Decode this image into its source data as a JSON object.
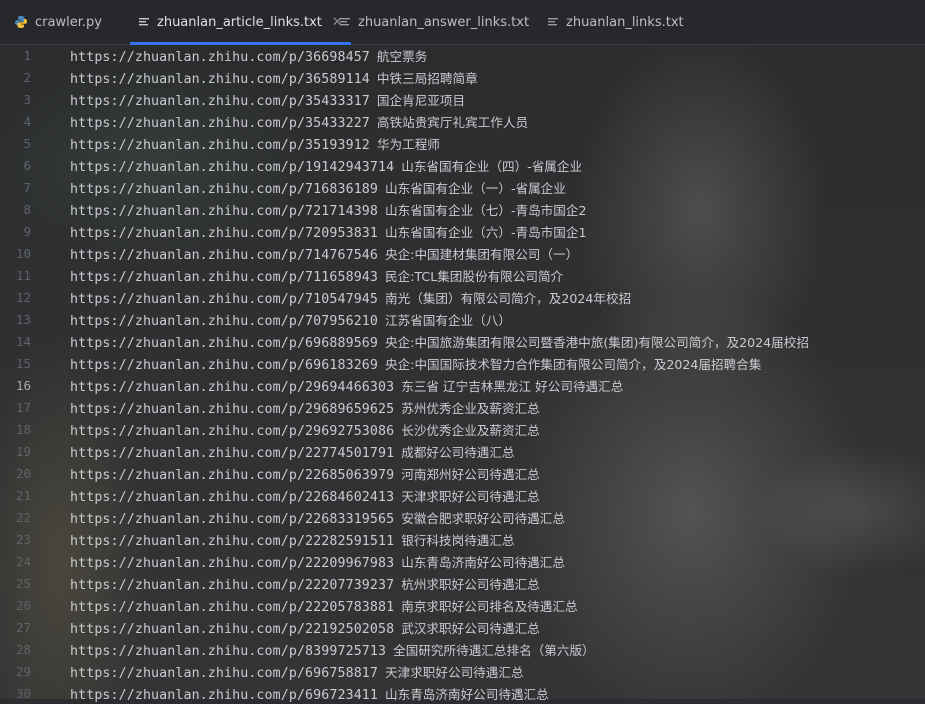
{
  "tabs": [
    {
      "label": "crawler.py",
      "icon": "python-file-icon",
      "active": false
    },
    {
      "label": "zhuanlan_article_links.txt",
      "icon": "text-file-icon",
      "active": true,
      "closable": true
    },
    {
      "label": "zhuanlan_answer_links.txt",
      "icon": "text-file-icon",
      "active": false
    },
    {
      "label": "zhuanlan_links.txt",
      "icon": "text-file-icon",
      "active": false
    }
  ],
  "current_line": 16,
  "lines": [
    {
      "n": "1",
      "url": "https://zhuanlan.zhihu.com/p/36698457",
      "title": "航空票务"
    },
    {
      "n": "2",
      "url": "https://zhuanlan.zhihu.com/p/36589114",
      "title": "中铁三局招聘简章"
    },
    {
      "n": "3",
      "url": "https://zhuanlan.zhihu.com/p/35433317",
      "title": "国企肯尼亚项目"
    },
    {
      "n": "4",
      "url": "https://zhuanlan.zhihu.com/p/35433227",
      "title": "高铁站贵宾厅礼宾工作人员"
    },
    {
      "n": "5",
      "url": "https://zhuanlan.zhihu.com/p/35193912",
      "title": "华为工程师"
    },
    {
      "n": "6",
      "url": "https://zhuanlan.zhihu.com/p/19142943714",
      "title": "山东省国有企业（四）-省属企业"
    },
    {
      "n": "7",
      "url": "https://zhuanlan.zhihu.com/p/716836189",
      "title": "山东省国有企业（一）-省属企业"
    },
    {
      "n": "8",
      "url": "https://zhuanlan.zhihu.com/p/721714398",
      "title": "山东省国有企业（七）-青岛市国企2"
    },
    {
      "n": "9",
      "url": "https://zhuanlan.zhihu.com/p/720953831",
      "title": "山东省国有企业（六）-青岛市国企1"
    },
    {
      "n": "10",
      "url": "https://zhuanlan.zhihu.com/p/714767546",
      "title": "央企:中国建材集团有限公司（一）"
    },
    {
      "n": "11",
      "url": "https://zhuanlan.zhihu.com/p/711658943",
      "title": "民企:TCL集团股份有限公司简介"
    },
    {
      "n": "12",
      "url": "https://zhuanlan.zhihu.com/p/710547945",
      "title": "南光（集团）有限公司简介，及2024年校招"
    },
    {
      "n": "13",
      "url": "https://zhuanlan.zhihu.com/p/707956210",
      "title": "江苏省国有企业（八）"
    },
    {
      "n": "14",
      "url": "https://zhuanlan.zhihu.com/p/696889569",
      "title": "央企:中国旅游集团有限公司暨香港中旅(集团)有限公司简介，及2024届校招"
    },
    {
      "n": "15",
      "url": "https://zhuanlan.zhihu.com/p/696183269",
      "title": "央企:中国国际技术智力合作集团有限公司简介，及2024届招聘合集"
    },
    {
      "n": "16",
      "url": "https://zhuanlan.zhihu.com/p/29694466303",
      "title": "东三省  辽宁吉林黑龙江  好公司待遇汇总"
    },
    {
      "n": "17",
      "url": "https://zhuanlan.zhihu.com/p/29689659625",
      "title": "苏州优秀企业及薪资汇总"
    },
    {
      "n": "18",
      "url": "https://zhuanlan.zhihu.com/p/29692753086",
      "title": "长沙优秀企业及薪资汇总"
    },
    {
      "n": "19",
      "url": "https://zhuanlan.zhihu.com/p/22774501791",
      "title": "成都好公司待遇汇总"
    },
    {
      "n": "20",
      "url": "https://zhuanlan.zhihu.com/p/22685063979",
      "title": "河南郑州好公司待遇汇总"
    },
    {
      "n": "21",
      "url": "https://zhuanlan.zhihu.com/p/22684602413",
      "title": "天津求职好公司待遇汇总"
    },
    {
      "n": "22",
      "url": "https://zhuanlan.zhihu.com/p/22683319565",
      "title": "安徽合肥求职好公司待遇汇总"
    },
    {
      "n": "23",
      "url": "https://zhuanlan.zhihu.com/p/22282591511",
      "title": "银行科技岗待遇汇总"
    },
    {
      "n": "24",
      "url": "https://zhuanlan.zhihu.com/p/22209967983",
      "title": "山东青岛济南好公司待遇汇总"
    },
    {
      "n": "25",
      "url": "https://zhuanlan.zhihu.com/p/22207739237",
      "title": "杭州求职好公司待遇汇总"
    },
    {
      "n": "26",
      "url": "https://zhuanlan.zhihu.com/p/22205783881",
      "title": "南京求职好公司排名及待遇汇总"
    },
    {
      "n": "27",
      "url": "https://zhuanlan.zhihu.com/p/22192502058",
      "title": "武汉求职好公司待遇汇总"
    },
    {
      "n": "28",
      "url": "https://zhuanlan.zhihu.com/p/8399725713",
      "title": "全国研究所待遇汇总排名（第六版）"
    },
    {
      "n": "29",
      "url": "https://zhuanlan.zhihu.com/p/696758817",
      "title": "天津求职好公司待遇汇总"
    },
    {
      "n": "30",
      "url": "https://zhuanlan.zhihu.com/p/696723411",
      "title": "山东青岛济南好公司待遇汇总"
    }
  ]
}
